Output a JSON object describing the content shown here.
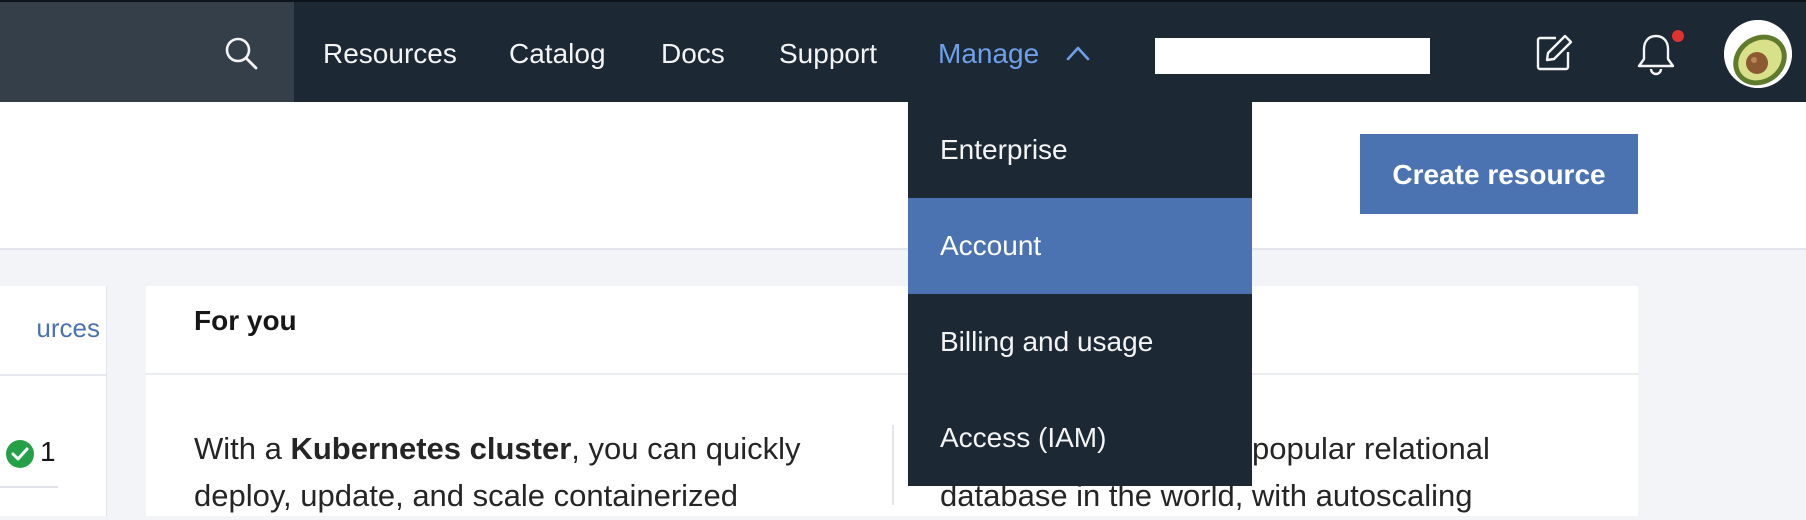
{
  "topnav": {
    "items": [
      {
        "label": "Resources"
      },
      {
        "label": "Catalog"
      },
      {
        "label": "Docs"
      },
      {
        "label": "Support"
      },
      {
        "label": "Manage"
      }
    ],
    "active_item": "Manage",
    "notification_dot": true,
    "icons": [
      "search-icon",
      "chevron-up-icon",
      "edit-icon",
      "bell-icon",
      "avatar"
    ],
    "colors": {
      "bar": "#1c2834",
      "search_zone": "#343f4a",
      "active": "#6fa0e9",
      "dot": "#e0322f"
    }
  },
  "manage_menu": {
    "items": [
      {
        "label": "Enterprise",
        "selected": false
      },
      {
        "label": "Account",
        "selected": true
      },
      {
        "label": "Billing and usage",
        "selected": false
      },
      {
        "label": "Access (IAM)",
        "selected": false
      }
    ]
  },
  "header": {
    "create_button": "Create resource",
    "accent": "#4b73b2"
  },
  "left_card": {
    "link_text": "urces",
    "count": "1",
    "status_icon": "check-circle-icon"
  },
  "main_card": {
    "title": "For you",
    "col1": {
      "line1_pre": "With a ",
      "line1_bold": "Kubernetes cluster",
      "line1_post": ", you can quickly",
      "line2": "deploy, update, and scale containerized"
    },
    "col2": {
      "line1": "popular relational",
      "line2": "database in the world, with autoscaling"
    }
  }
}
